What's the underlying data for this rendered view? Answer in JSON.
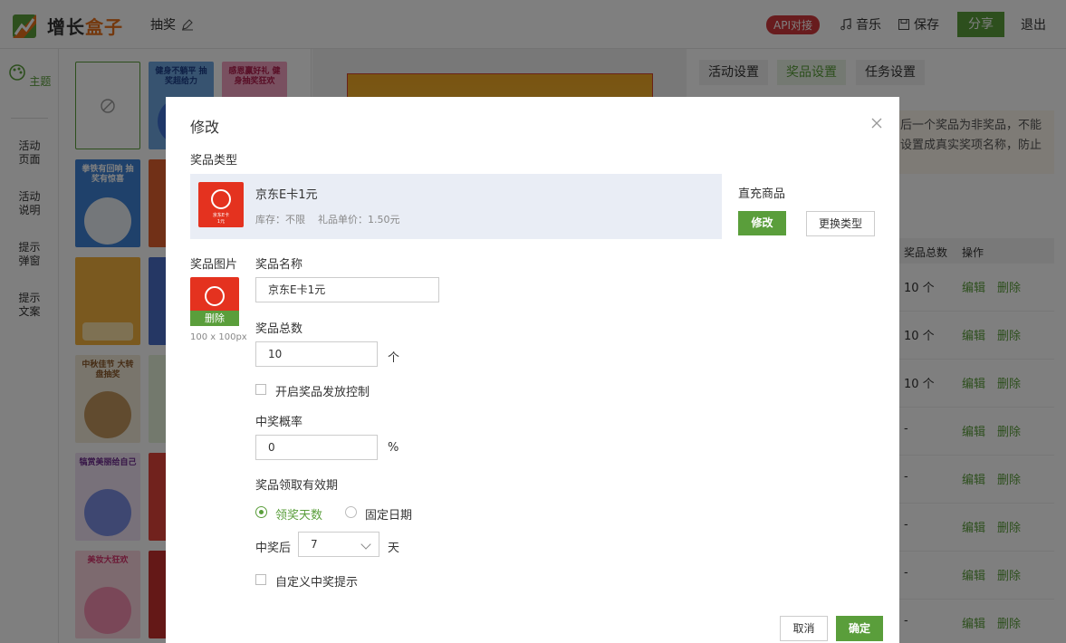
{
  "colors": {
    "accent": "#5a9e3b",
    "brand_orange": "#e8711a",
    "api_red": "#d0393c",
    "jd_red": "#e4321f"
  },
  "header": {
    "logo_text_part1": "增长",
    "logo_text_part2": "盒子",
    "page_name": "抽奖",
    "api_badge": "API对接",
    "music_label": "音乐",
    "save_label": "保存",
    "share_label": "分享",
    "logout_label": "退出"
  },
  "sidebar": {
    "theme_label": "主题",
    "items": [
      {
        "line1": "活动",
        "line2": "页面"
      },
      {
        "line1": "活动",
        "line2": "说明"
      },
      {
        "line1": "提示",
        "line2": "弹窗"
      },
      {
        "line1": "提示",
        "line2": "文案"
      }
    ]
  },
  "templates": [
    {
      "title": "健身不躺平 抽奖超给力"
    },
    {
      "title": "感恩赢好礼 健身抽奖狂欢"
    },
    {
      "title": "拳铁有回响 抽奖有惊喜"
    },
    {
      "title": "中秋佳节 大转盘抽奖"
    },
    {
      "title": "犒赏美丽给自己"
    },
    {
      "title": "美妆大狂欢"
    }
  ],
  "settings": {
    "tabs": [
      "活动设置",
      "奖品设置",
      "任务设置"
    ],
    "notice_line1": "后一个奖品为非奖品，不能",
    "notice_line2": "设置成真实奖项名称，防止",
    "table_headers": {
      "total": "奖品总数",
      "actions": "操作"
    },
    "rows": [
      {
        "count": "10 个"
      },
      {
        "count": "10 个"
      },
      {
        "count": "10 个"
      },
      {
        "count": "-"
      },
      {
        "count": "-"
      },
      {
        "count": "-"
      },
      {
        "count": "-"
      },
      {
        "count": "-"
      }
    ],
    "edit_label": "编辑",
    "delete_label": "删除"
  },
  "modal": {
    "title": "修改",
    "prize_type_label": "奖品类型",
    "prize": {
      "name": "京东E卡1元",
      "stock": "库存：不限",
      "unit_price": "礼品单价：1.50元",
      "card_text_top": "京东E卡",
      "card_text_amount": "1元",
      "kind": "直充商品"
    },
    "modify_button": "修改",
    "change_type_button": "更换类型",
    "prize_image_label": "奖品图片",
    "image_delete": "删除",
    "image_size_hint": "100 x 100px",
    "prize_name_label": "奖品名称",
    "prize_name_value": "京东E卡1元",
    "total_label": "奖品总数",
    "total_value": "10",
    "total_unit": "个",
    "distribution_control_label": "开启奖品发放控制",
    "probability_label": "中奖概率",
    "probability_value": "0",
    "probability_unit": "%",
    "validity_label": "奖品领取有效期",
    "validity_options": [
      "领奖天数",
      "固定日期"
    ],
    "after_win_label": "中奖后",
    "days_value": "7",
    "days_unit": "天",
    "custom_prompt_label": "自定义中奖提示",
    "cancel_button": "取消",
    "confirm_button": "确定"
  }
}
